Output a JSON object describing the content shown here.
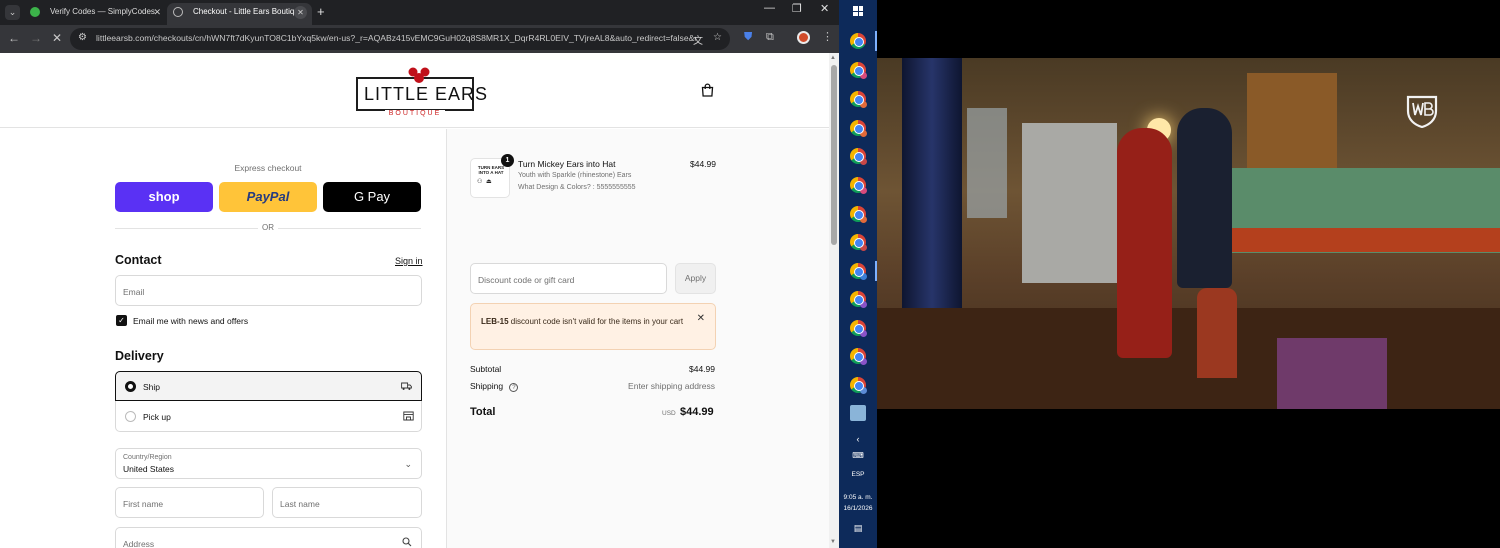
{
  "browser": {
    "tabs": [
      {
        "title": "Verify Codes — SimplyCodes",
        "active": false
      },
      {
        "title": "Checkout - Little Ears Boutique",
        "active": true
      }
    ],
    "url": "littleearsb.com/checkouts/cn/hWN7ft7dKyunTO8C1bYxq5kw/en-us?_r=AQABz415vEMC9GuH02q8S8MR1X_DqrR4RL0EIV_TVjreAL8&auto_redirect=false&e..."
  },
  "store": {
    "logo_main": "LITTLE EARS",
    "logo_sub": "BOUTIQUE"
  },
  "checkout": {
    "express_title": "Express checkout",
    "shop_label": "shop",
    "paypal_label": "PayPal",
    "gpay_label": "G Pay",
    "or_label": "OR",
    "contact_heading": "Contact",
    "sign_in": "Sign in",
    "email_placeholder": "Email",
    "news_label": "Email me with news and offers",
    "news_checked": true,
    "delivery_heading": "Delivery",
    "delivery_options": [
      {
        "label": "Ship",
        "selected": true,
        "icon": "truck-icon"
      },
      {
        "label": "Pick up",
        "selected": false,
        "icon": "store-icon"
      }
    ],
    "country_label": "Country/Region",
    "country_value": "United States",
    "first_name_placeholder": "First name",
    "last_name_placeholder": "Last name",
    "address_placeholder": "Address"
  },
  "summary": {
    "item": {
      "quantity": "1",
      "name": "Turn Mickey Ears into Hat",
      "variant": "Youth with Sparkle (rhinestone) Ears",
      "option": "What Design & Colors? : 5555555555",
      "price": "$44.99",
      "thumb_text": "TURN EARS INTO A HAT",
      "thumb_art": "⚇ ⏏"
    },
    "discount_placeholder": "Discount code or gift card",
    "apply_label": "Apply",
    "alert_code": "LEB-15",
    "alert_message": " discount code isn't valid for the items in your cart",
    "subtotal_label": "Subtotal",
    "subtotal_value": "$44.99",
    "shipping_label": "Shipping",
    "shipping_value": "Enter shipping address",
    "total_label": "Total",
    "total_currency": "USD",
    "total_value": "$44.99"
  },
  "taskbar": {
    "language": "ESP",
    "time": "9:05 a. m.",
    "date": "16/1/2026"
  },
  "colors": {
    "shop": "#5a31f4",
    "paypal": "#ffc439",
    "alert_bg": "#fff1e4",
    "taskbar": "#0d2a5a"
  }
}
